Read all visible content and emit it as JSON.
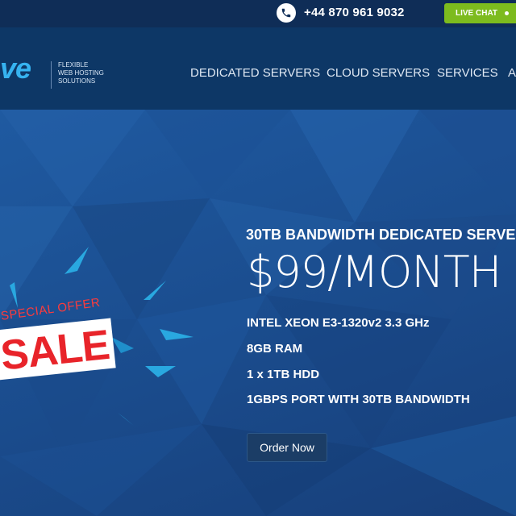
{
  "topbar": {
    "phone_icon": "phone-icon",
    "phone": "+44 870 961 9032",
    "live_chat_label": "LIVE CHAT"
  },
  "header": {
    "logo_text": "ve",
    "tagline_lines": [
      "FLEXIBLE",
      "WEB HOSTING",
      "SOLUTIONS"
    ],
    "nav": [
      "DEDICATED SERVERS",
      "CLOUD SERVERS",
      "SERVICES",
      "A"
    ]
  },
  "hero": {
    "badge_top": "SPECIAL OFFER",
    "badge_main": "SALE",
    "title": "30TB BANDWIDTH DEDICATED SERVE",
    "price": "$99/MONTH",
    "specs": [
      "INTEL XEON E3-1320v2 3.3 GHz",
      "8GB RAM",
      "1 x 1TB HDD",
      "1GBPS PORT WITH 30TB BANDWIDTH"
    ],
    "cta": "Order Now"
  },
  "colors": {
    "topbar_bg": "#0f2d57",
    "header_bg": "#0d3766",
    "hero_bg": "#1b4e90",
    "live_chat": "#7dbb1e",
    "logo": "#36b3f0",
    "sale_red": "#e8242a",
    "accent_cyan": "#29a8e0"
  }
}
